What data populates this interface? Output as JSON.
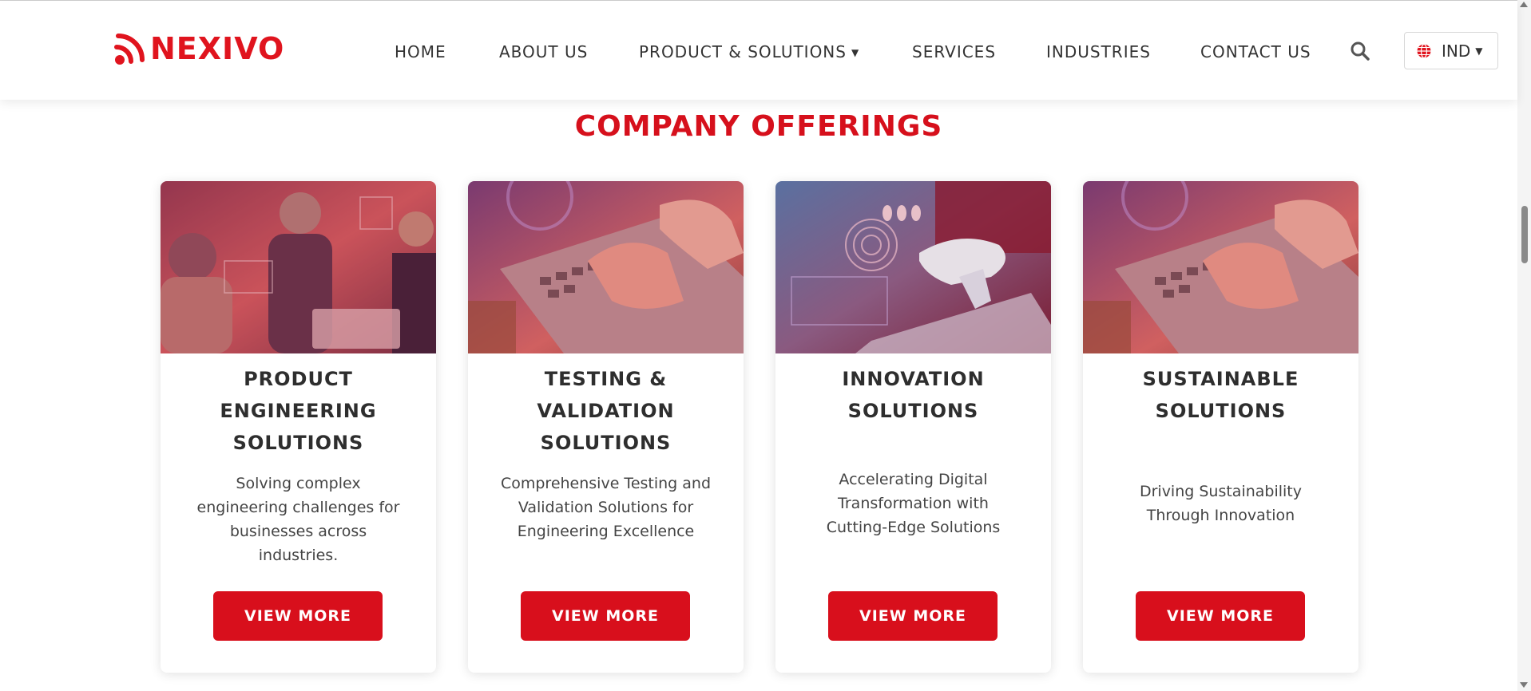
{
  "brand": {
    "name": "NEXIVO",
    "logo_icon": "rss-feed-icon",
    "accent_color": "#e0141e"
  },
  "nav": {
    "items": [
      {
        "label": "HOME"
      },
      {
        "label": "ABOUT US"
      },
      {
        "label": "PRODUCT & SOLUTIONS",
        "has_dropdown": true
      },
      {
        "label": "SERVICES"
      },
      {
        "label": "INDUSTRIES"
      },
      {
        "label": "CONTACT US"
      }
    ],
    "search_icon": "search-icon",
    "language": {
      "label": "IND",
      "icon": "globe-icon"
    }
  },
  "section": {
    "title": "COMPANY OFFERINGS",
    "cards": [
      {
        "title": "PRODUCT ENGINEERING SOLUTIONS",
        "description": "Solving complex engineering challenges for businesses across industries.",
        "button": "VIEW MORE"
      },
      {
        "title": "TESTING & VALIDATION SOLUTIONS",
        "description": "Comprehensive Testing and Validation Solutions for Engineering Excellence",
        "button": "VIEW MORE"
      },
      {
        "title": "INNOVATION SOLUTIONS",
        "description": "Accelerating Digital Transformation with Cutting-Edge Solutions",
        "button": "VIEW MORE"
      },
      {
        "title": "SUSTAINABLE SOLUTIONS",
        "description": "Driving Sustainability Through Innovation",
        "button": "VIEW MORE"
      }
    ]
  },
  "colors": {
    "button_bg": "#d80f1c",
    "title_red": "#d6101c"
  }
}
